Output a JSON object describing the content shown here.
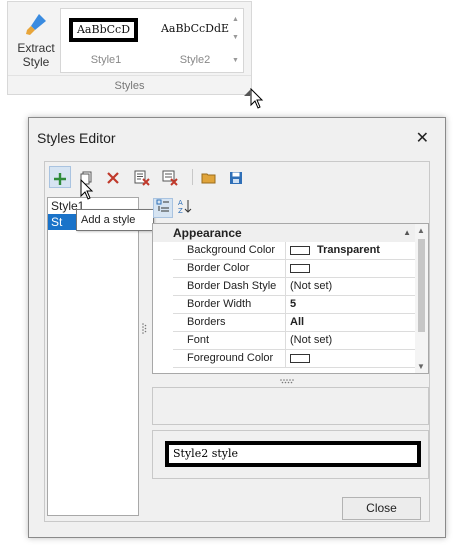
{
  "ribbon": {
    "extract_button": {
      "label_line1": "Extract",
      "label_line2": "Style",
      "icon": "brush-icon"
    },
    "gallery": {
      "items": [
        {
          "sample": "AaBbCcD",
          "caption": "Style1"
        },
        {
          "sample": "AaBbCcDdE",
          "caption": "Style2"
        }
      ]
    },
    "group_caption": "Styles"
  },
  "dialog": {
    "title": "Styles Editor",
    "toolbar": [
      {
        "name": "add-style-button",
        "icon": "plus-icon"
      },
      {
        "name": "copy-style-button",
        "icon": "copy-icon"
      },
      {
        "name": "delete-style-button",
        "icon": "delete-icon"
      },
      {
        "name": "purge-styles-button",
        "icon": "purge-icon"
      },
      {
        "name": "clear-styles-button",
        "icon": "clear-icon"
      },
      {
        "name": "open-file-button",
        "icon": "folder-icon"
      },
      {
        "name": "save-file-button",
        "icon": "save-icon"
      }
    ],
    "tooltip": "Add a style",
    "style_list": [
      "Style1",
      "St"
    ],
    "property_grid": {
      "category": "Appearance",
      "rows": [
        {
          "name": "Background Color",
          "value": "Transparent",
          "swatch": true,
          "bold": true
        },
        {
          "name": "Border Color",
          "value": "",
          "swatch": true,
          "bold": false
        },
        {
          "name": "Border Dash Style",
          "value": "(Not set)",
          "swatch": false,
          "bold": false
        },
        {
          "name": "Border Width",
          "value": "5",
          "swatch": false,
          "bold": true
        },
        {
          "name": "Borders",
          "value": "All",
          "swatch": false,
          "bold": true
        },
        {
          "name": "Font",
          "value": "(Not set)",
          "swatch": false,
          "bold": false
        },
        {
          "name": "Foreground Color",
          "value": "",
          "swatch": true,
          "bold": false
        }
      ]
    },
    "preview_text": "Style2 style",
    "close_button": "Close"
  },
  "colors": {
    "accent": "#1a73c9",
    "add_icon": "#2e8b3a",
    "delete_icon": "#c0392b"
  }
}
